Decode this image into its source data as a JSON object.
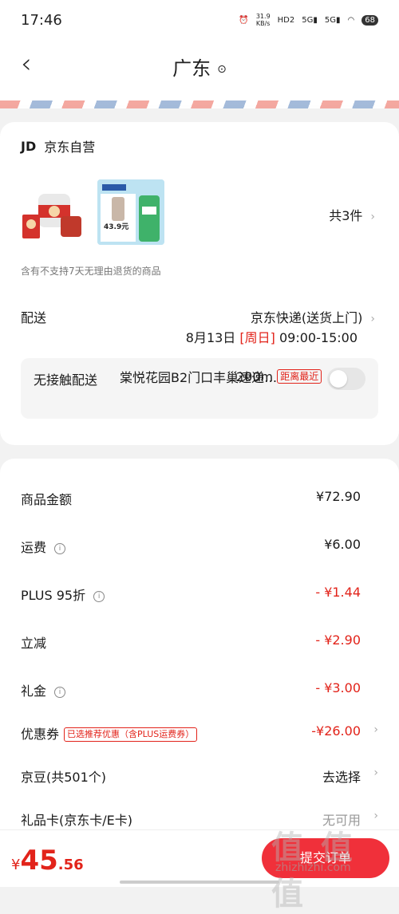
{
  "status_bar": {
    "time": "17:46",
    "net_speed": "31.9\nKB/s",
    "hd": "HD2",
    "sig1": "5G",
    "sig2": "5G",
    "battery": "68"
  },
  "header": {
    "title": "广东"
  },
  "shop": {
    "logo": "JD",
    "name": "京东自营"
  },
  "products": {
    "count_label": "共3件",
    "price_badge": "43.9元"
  },
  "return_note": "含有不支持7天无理由退货的商品",
  "delivery": {
    "label": "配送",
    "method": "京东快递(送货上门)",
    "date": "8月13日",
    "day": "[周日]",
    "time_range": "09:00-15:00"
  },
  "contactless": {
    "label": "无接触配送",
    "address": "棠悦花园B2门口丰巢速递…",
    "distance": "200m",
    "nearest_tag": "距离最近"
  },
  "fees": [
    {
      "label": "商品金额",
      "value": "¥72.90",
      "info": false,
      "style": "normal"
    },
    {
      "label": "运费",
      "value": "¥6.00",
      "info": true,
      "style": "normal"
    },
    {
      "label": "PLUS 95折",
      "value": "- ¥1.44",
      "info": true,
      "style": "red"
    },
    {
      "label": "立减",
      "value": "- ¥2.90",
      "info": false,
      "style": "red"
    },
    {
      "label": "礼金",
      "value": "- ¥3.00",
      "info": true,
      "style": "red"
    }
  ],
  "coupon": {
    "label": "优惠券",
    "tag": "已选推荐优惠（含PLUS运费券）",
    "value": "-¥26.00"
  },
  "jingdou": {
    "label": "京豆(共501个)",
    "value": "去选择"
  },
  "giftcard": {
    "label": "礼品卡(京东卡/E卡)",
    "value": "无可用"
  },
  "footer": {
    "currency": "¥",
    "total_int": "45",
    "total_dec": ".56",
    "submit_label": "提交订单"
  },
  "watermark": {
    "text": "值 值 值",
    "url": "zhizhizhi.com"
  },
  "colors": {
    "accent": "#e2231a",
    "submit_bg": "#f0303a"
  }
}
